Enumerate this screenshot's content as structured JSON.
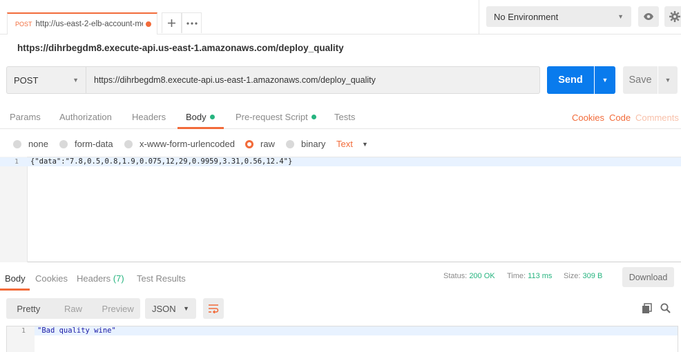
{
  "tab": {
    "method": "POST",
    "title": "http://us-east-2-elb-account-me"
  },
  "environment": {
    "selected": "No Environment"
  },
  "request": {
    "name": "https://dihrbegdm8.execute-api.us-east-1.amazonaws.com/deploy_quality",
    "method": "POST",
    "url": "https://dihrbegdm8.execute-api.us-east-1.amazonaws.com/deploy_quality",
    "send_label": "Send",
    "save_label": "Save"
  },
  "request_tabs": {
    "params": "Params",
    "authorization": "Authorization",
    "headers": "Headers",
    "body": "Body",
    "prerequest": "Pre-request Script",
    "tests": "Tests",
    "cookies": "Cookies",
    "code": "Code",
    "comments": "Comments"
  },
  "body_types": {
    "none": "none",
    "form_data": "form-data",
    "urlencoded": "x-www-form-urlencoded",
    "raw": "raw",
    "binary": "binary",
    "text_type": "Text"
  },
  "editor": {
    "line": "1",
    "code": "{\"data\":\"7.8,0.5,0.8,1.9,0.075,12,29,0.9959,3.31,0.56,12.4\"}"
  },
  "response_tabs": {
    "body": "Body",
    "cookies": "Cookies",
    "headers": "Headers",
    "headers_count": "(7)",
    "test_results": "Test Results"
  },
  "response_status": {
    "status_label": "Status:",
    "status_value": "200 OK",
    "time_label": "Time:",
    "time_value": "113 ms",
    "size_label": "Size:",
    "size_value": "309 B",
    "download_label": "Download"
  },
  "response_format": {
    "pretty": "Pretty",
    "raw": "Raw",
    "preview": "Preview",
    "language": "JSON"
  },
  "response_body": {
    "line": "1",
    "content": "\"Bad quality wine\""
  },
  "colors": {
    "accent": "#f26b3a",
    "send": "#097bed",
    "success": "#26b47f"
  }
}
